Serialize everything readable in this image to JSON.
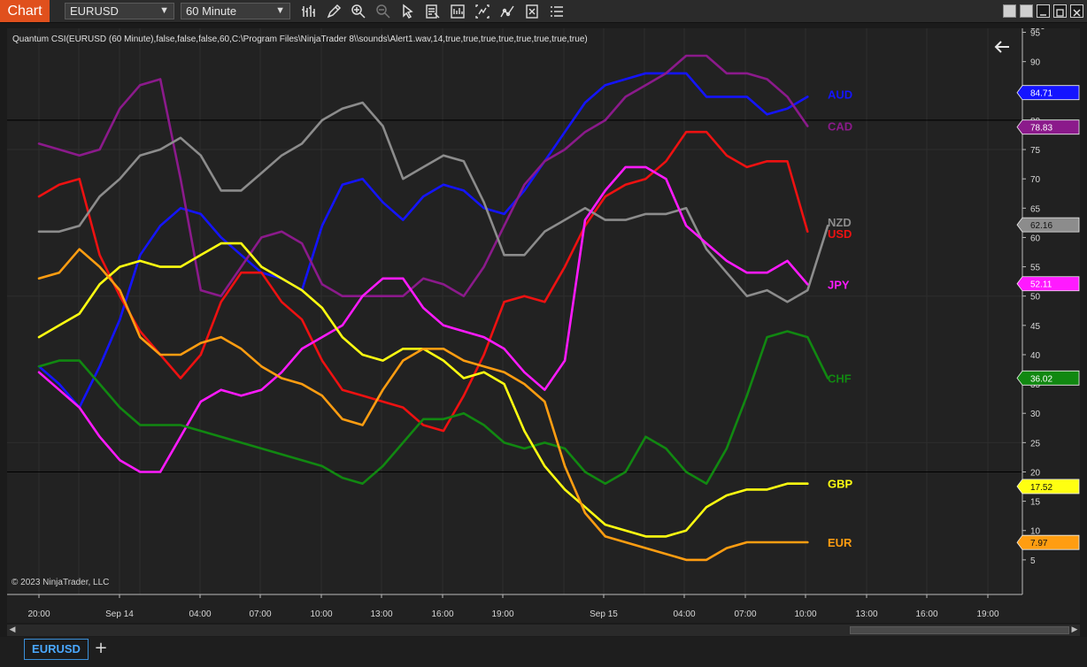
{
  "toolbar": {
    "chart_tab": "Chart",
    "instrument": "EURUSD",
    "interval": "60 Minute"
  },
  "chart": {
    "indicator_label": "Quantum CSI(EURUSD (60 Minute),false,false,false,60,C:\\Program Files\\NinjaTrader 8\\\\sounds\\Alert1.wav,14,true,true,true,true,true,true,true,true)",
    "copyright": "© 2023 NinjaTrader, LLC",
    "top_tick_partial": "100",
    "y_ticks": [
      "5",
      "10",
      "15",
      "20",
      "25",
      "30",
      "35",
      "40",
      "45",
      "50",
      "55",
      "60",
      "65",
      "70",
      "75",
      "80",
      "85",
      "90",
      "95"
    ],
    "x_tick_labels": [
      "20:00",
      "Sep 14",
      "04:00",
      "07:00",
      "10:00",
      "13:00",
      "16:00",
      "19:00",
      "Sep 15",
      "04:00",
      "07:00",
      "10:00",
      "13:00",
      "16:00",
      "19:00"
    ],
    "level_lines": [
      80,
      20
    ]
  },
  "chart_data": {
    "type": "line",
    "ylim": [
      0,
      100
    ],
    "series": [
      {
        "name": "AUD",
        "color": "#1414ff",
        "last": "84.71",
        "values": [
          38,
          35,
          31,
          38,
          46,
          57,
          62,
          65,
          64,
          60,
          57,
          54,
          53,
          51,
          62,
          69,
          70,
          66,
          63,
          67,
          69,
          68,
          65,
          64,
          68,
          73,
          78,
          83,
          86,
          87,
          88,
          88,
          88,
          84,
          84,
          84,
          81,
          82,
          84
        ]
      },
      {
        "name": "CAD",
        "color": "#8b1a8b",
        "last": "78.83",
        "values": [
          76,
          75,
          74,
          75,
          82,
          86,
          87,
          70,
          51,
          50,
          55,
          60,
          61,
          59,
          52,
          50,
          50,
          50,
          50,
          53,
          52,
          50,
          55,
          62,
          69,
          73,
          75,
          78,
          80,
          84,
          86,
          88,
          91,
          91,
          88,
          88,
          87,
          84,
          79
        ]
      },
      {
        "name": "USD",
        "color": "#ee1111",
        "last": "",
        "values": [
          67,
          69,
          70,
          57,
          50,
          44,
          40,
          36,
          40,
          49,
          54,
          54,
          49,
          46,
          39,
          34,
          33,
          32,
          31,
          28,
          27,
          33,
          40,
          49,
          50,
          49,
          55,
          62,
          67,
          69,
          70,
          73,
          78,
          78,
          74,
          72,
          73,
          73,
          61
        ]
      },
      {
        "name": "NZD",
        "color": "#8c8c8c",
        "last": "62.16",
        "values": [
          61,
          61,
          62,
          67,
          70,
          74,
          75,
          77,
          74,
          68,
          68,
          71,
          74,
          76,
          80,
          82,
          83,
          79,
          70,
          72,
          74,
          73,
          66,
          57,
          57,
          61,
          63,
          65,
          63,
          63,
          64,
          64,
          65,
          58,
          54,
          50,
          51,
          49,
          51,
          62
        ]
      },
      {
        "name": "JPY",
        "color": "#ff1aff",
        "last": "52.11",
        "values": [
          37,
          34,
          31,
          26,
          22,
          20,
          20,
          26,
          32,
          34,
          33,
          34,
          37,
          41,
          43,
          45,
          50,
          53,
          53,
          48,
          45,
          44,
          43,
          41,
          37,
          34,
          39,
          63,
          68,
          72,
          72,
          70,
          62,
          59,
          56,
          54,
          54,
          56,
          52
        ]
      },
      {
        "name": "CHF",
        "color": "#118811",
        "last": "36.02",
        "values": [
          38,
          39,
          39,
          35,
          31,
          28,
          28,
          28,
          27,
          26,
          25,
          24,
          23,
          22,
          21,
          19,
          18,
          21,
          25,
          29,
          29,
          30,
          28,
          25,
          24,
          25,
          24,
          20,
          18,
          20,
          26,
          24,
          20,
          18,
          24,
          33,
          43,
          44,
          43,
          36
        ]
      },
      {
        "name": "GBP",
        "color": "#ffff11",
        "last": "17.52",
        "values": [
          43,
          45,
          47,
          52,
          55,
          56,
          55,
          55,
          57,
          59,
          59,
          55,
          53,
          51,
          48,
          43,
          40,
          39,
          41,
          41,
          39,
          36,
          37,
          35,
          27,
          21,
          17,
          14,
          11,
          10,
          9,
          9,
          10,
          14,
          16,
          17,
          17,
          18,
          18
        ]
      },
      {
        "name": "EUR",
        "color": "#ff9d11",
        "last": "7.97",
        "values": [
          53,
          54,
          58,
          55,
          51,
          43,
          40,
          40,
          42,
          43,
          41,
          38,
          36,
          35,
          33,
          29,
          28,
          34,
          39,
          41,
          41,
          39,
          38,
          37,
          35,
          32,
          21,
          13,
          9,
          8,
          7,
          6,
          5,
          5,
          7,
          8,
          8,
          8,
          8
        ]
      }
    ]
  },
  "bottom_tabs": {
    "active": "EURUSD",
    "add": "+"
  }
}
